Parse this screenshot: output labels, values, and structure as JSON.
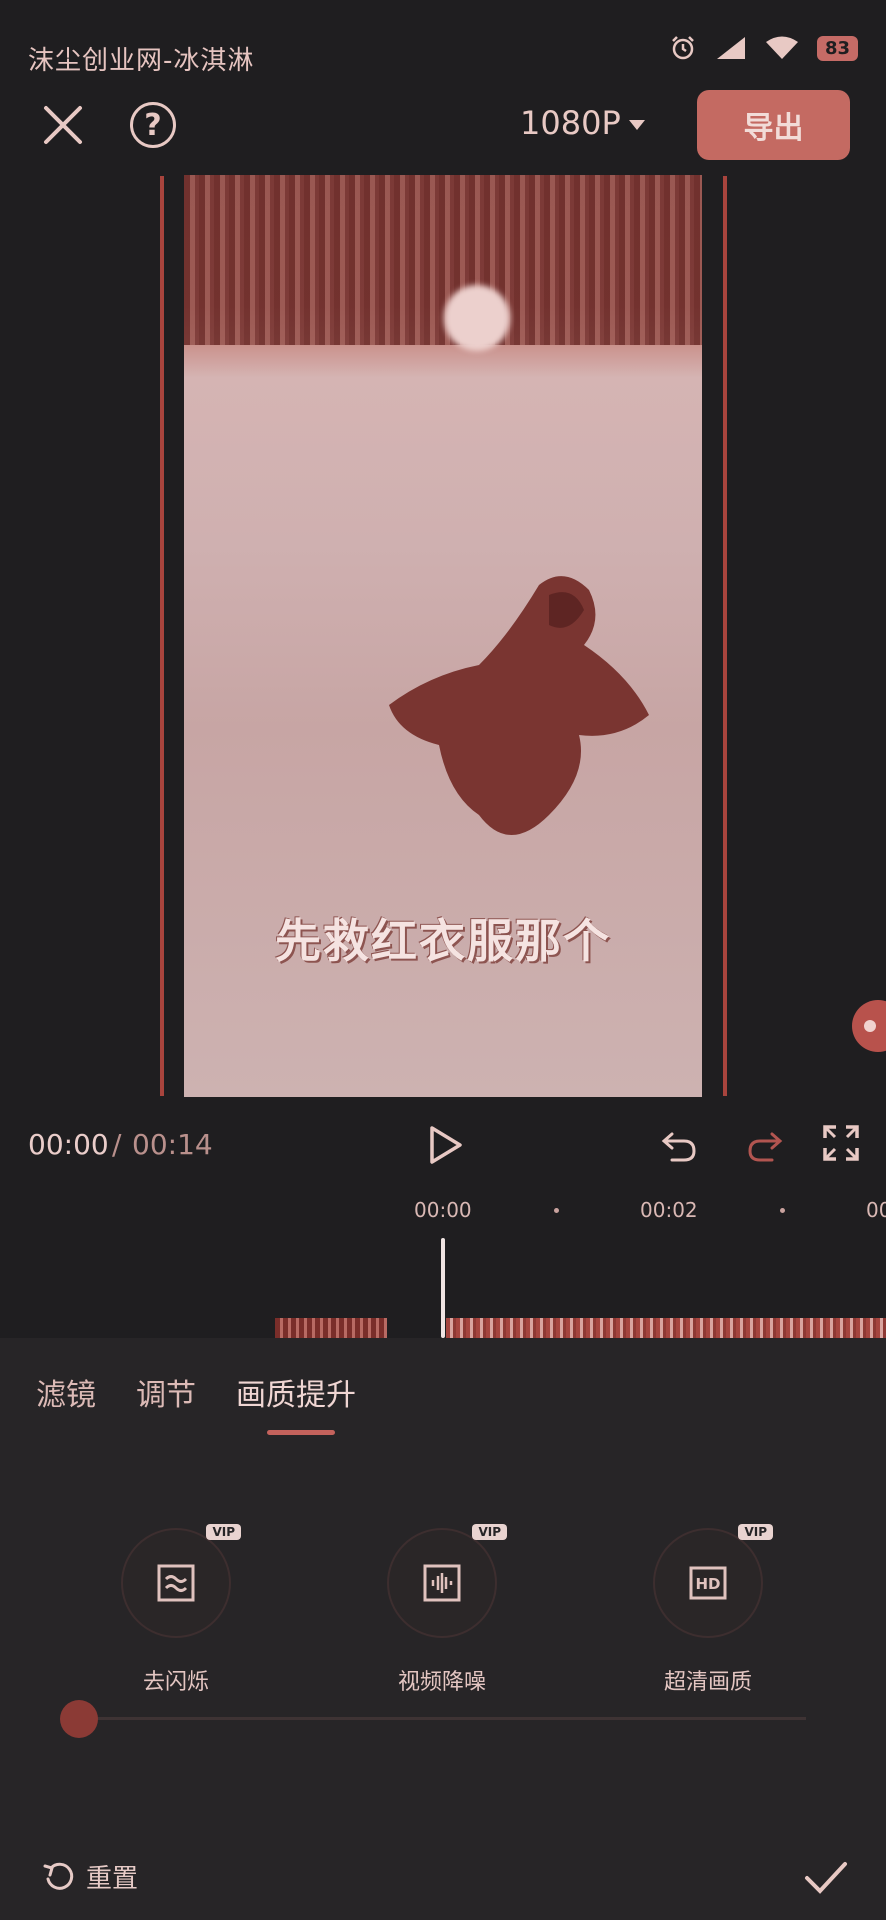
{
  "status_bar": {
    "left_text": "沫尘创业网-冰淇淋",
    "battery": "83"
  },
  "toolbar": {
    "resolution": "1080P",
    "export_label": "导出"
  },
  "preview": {
    "caption": "先救红衣服那个"
  },
  "playback": {
    "current_time": "00:00",
    "separator": "/",
    "total_time": "00:14"
  },
  "timeline": {
    "markers": [
      "00:00",
      "00:02",
      "00"
    ]
  },
  "panel": {
    "tabs": [
      "滤镜",
      "调节",
      "画质提升"
    ],
    "active_tab": 2,
    "features": [
      {
        "label": "去闪烁",
        "badge": "VIP",
        "icon": "deflicker-icon"
      },
      {
        "label": "视频降噪",
        "badge": "VIP",
        "icon": "noise-reduction-icon"
      },
      {
        "label": "超清画质",
        "badge": "VIP",
        "icon": "hd-icon"
      }
    ],
    "reset_label": "重置"
  },
  "colors": {
    "accent": "#c46a62",
    "background": "#1f1e20",
    "panel": "#272527"
  }
}
